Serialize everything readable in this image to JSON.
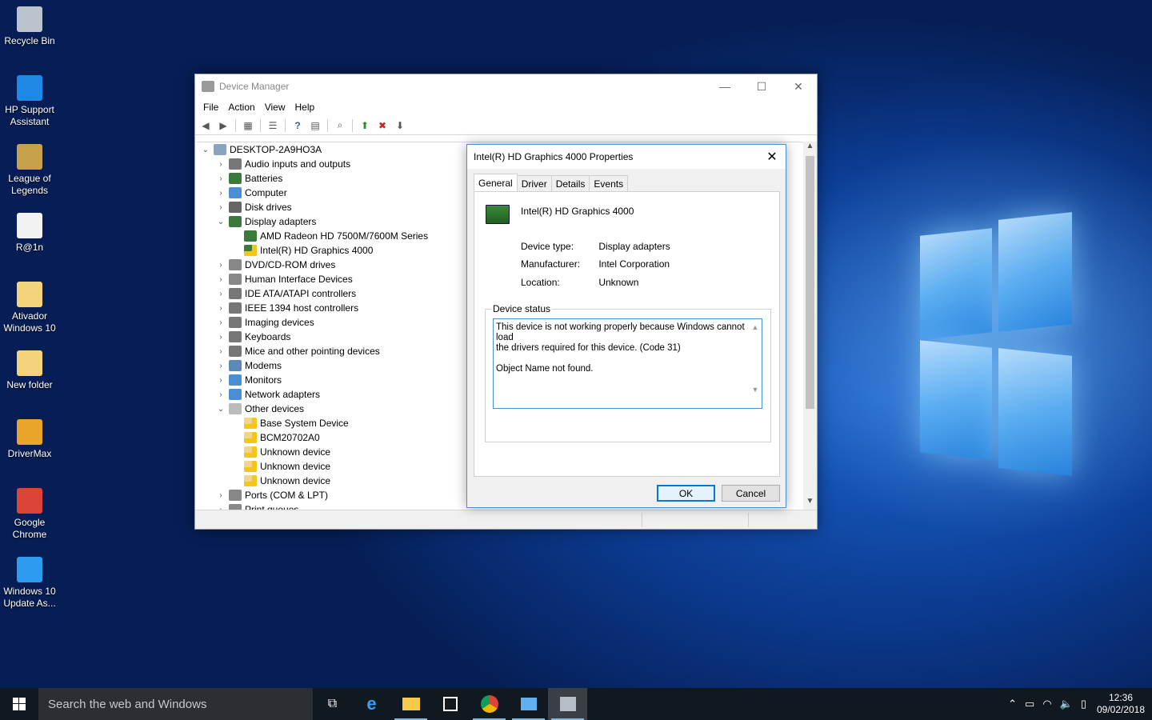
{
  "desktop": {
    "icons": [
      {
        "label1": "Recycle Bin",
        "label2": "",
        "name": "recycle-bin-icon",
        "color": "#b9c4cf"
      },
      {
        "label1": "HP Support",
        "label2": "Assistant",
        "name": "hp-support-assistant-icon",
        "color": "#1e88e5"
      },
      {
        "label1": "League of",
        "label2": "Legends",
        "name": "league-of-legends-icon",
        "color": "#c8a24a"
      },
      {
        "label1": "R@1n",
        "label2": "",
        "name": "text-file-icon",
        "color": "#f2f2f2"
      },
      {
        "label1": "Ativador",
        "label2": "Windows 10",
        "name": "ativador-folder-icon",
        "color": "#f5d37a"
      },
      {
        "label1": "New folder",
        "label2": "",
        "name": "new-folder-icon",
        "color": "#f5d37a"
      },
      {
        "label1": "DriverMax",
        "label2": "",
        "name": "drivermax-icon",
        "color": "#e8a52a"
      },
      {
        "label1": "Google",
        "label2": "Chrome",
        "name": "google-chrome-icon",
        "color": "#db4437"
      },
      {
        "label1": "Windows 10",
        "label2": "Update As...",
        "name": "windows-10-update-assistant-icon",
        "color": "#2d9bf0"
      }
    ]
  },
  "device_manager": {
    "title": "Device Manager",
    "menu": [
      "File",
      "Action",
      "View",
      "Help"
    ],
    "tree": {
      "root": "DESKTOP-2A9HO3A",
      "items": [
        {
          "label": "Audio inputs and outputs",
          "expander": ">",
          "level": 1
        },
        {
          "label": "Batteries",
          "expander": ">",
          "level": 1
        },
        {
          "label": "Computer",
          "expander": ">",
          "level": 1
        },
        {
          "label": "Disk drives",
          "expander": ">",
          "level": 1
        },
        {
          "label": "Display adapters",
          "expander": "v",
          "level": 1
        },
        {
          "label": "AMD Radeon HD 7500M/7600M Series",
          "expander": "",
          "level": 2
        },
        {
          "label": "Intel(R) HD Graphics 4000",
          "expander": "",
          "level": 2,
          "warning": true
        },
        {
          "label": "DVD/CD-ROM drives",
          "expander": ">",
          "level": 1
        },
        {
          "label": "Human Interface Devices",
          "expander": ">",
          "level": 1
        },
        {
          "label": "IDE ATA/ATAPI controllers",
          "expander": ">",
          "level": 1
        },
        {
          "label": "IEEE 1394 host controllers",
          "expander": ">",
          "level": 1
        },
        {
          "label": "Imaging devices",
          "expander": ">",
          "level": 1
        },
        {
          "label": "Keyboards",
          "expander": ">",
          "level": 1
        },
        {
          "label": "Mice and other pointing devices",
          "expander": ">",
          "level": 1
        },
        {
          "label": "Modems",
          "expander": ">",
          "level": 1
        },
        {
          "label": "Monitors",
          "expander": ">",
          "level": 1
        },
        {
          "label": "Network adapters",
          "expander": ">",
          "level": 1
        },
        {
          "label": "Other devices",
          "expander": "v",
          "level": 1
        },
        {
          "label": "Base System Device",
          "expander": "",
          "level": 2,
          "warning": true
        },
        {
          "label": "BCM20702A0",
          "expander": "",
          "level": 2,
          "warning": true
        },
        {
          "label": "Unknown device",
          "expander": "",
          "level": 2,
          "warning": true
        },
        {
          "label": "Unknown device",
          "expander": "",
          "level": 2,
          "warning": true
        },
        {
          "label": "Unknown device",
          "expander": "",
          "level": 2,
          "warning": true
        },
        {
          "label": "Ports (COM & LPT)",
          "expander": ">",
          "level": 1
        },
        {
          "label": "Print queues",
          "expander": ">",
          "level": 1
        }
      ]
    }
  },
  "properties": {
    "title": "Intel(R) HD Graphics 4000 Properties",
    "tabs": [
      "General",
      "Driver",
      "Details",
      "Events"
    ],
    "device_name": "Intel(R) HD Graphics 4000",
    "device_type_label": "Device type:",
    "device_type": "Display adapters",
    "manufacturer_label": "Manufacturer:",
    "manufacturer": "Intel Corporation",
    "location_label": "Location:",
    "location": "Unknown",
    "status_legend": "Device status",
    "status_line1": "This device is not working properly because Windows cannot load",
    "status_line2": "the drivers required for this device. (Code 31)",
    "status_line3": "Object Name not found.",
    "ok_label": "OK",
    "cancel_label": "Cancel"
  },
  "taskbar": {
    "search_placeholder": "Search the web and Windows",
    "time": "12:36",
    "date": "09/02/2018"
  }
}
